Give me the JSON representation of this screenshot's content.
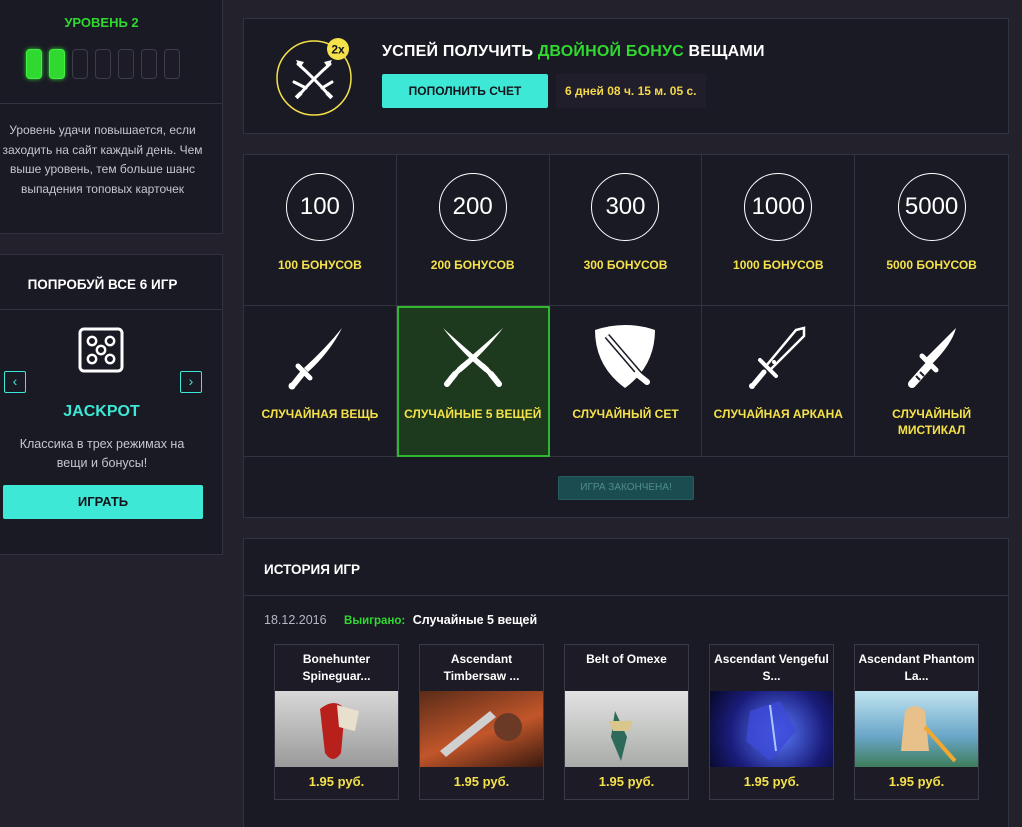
{
  "level": {
    "title": "УРОВЕНЬ 2",
    "bars_total": 7,
    "bars_filled": 2,
    "description": "Уровень удачи повышается, если заходить на сайт каждый день. Чем выше уровень, тем больше шанс выпадения топовых карточек"
  },
  "games_promo": {
    "title": "ПОПРОБУЙ ВСЕ 6 ИГР",
    "prev_icon": "‹",
    "next_icon": "›",
    "game_name": "JACKPOT",
    "game_description": "Классика в трех режимах на вещи и бонусы!",
    "play_label": "ИГРАТЬ",
    "game_icon": "dice-icon"
  },
  "bonus_banner": {
    "badge": "2x",
    "headline_prefix": "УСПЕЙ ПОЛУЧИТЬ",
    "headline_highlight": "ДВОЙНОЙ БОНУС",
    "headline_suffix": "ВЕЩАМИ",
    "topup_label": "ПОПОЛНИТЬ СЧЕТ",
    "timer": "6 дней 08 ч. 15 м. 05 с.",
    "accent_color": "#2fd92f",
    "badge_color": "#f5e24a"
  },
  "bonus_options": [
    {
      "amount": "100",
      "label": "100 БОНУСОВ"
    },
    {
      "amount": "200",
      "label": "200 БОНУСОВ"
    },
    {
      "amount": "300",
      "label": "300 БОНУСОВ"
    },
    {
      "amount": "1000",
      "label": "1000 БОНУСОВ"
    },
    {
      "amount": "5000",
      "label": "5000 БОНУСОВ"
    }
  ],
  "item_options": [
    {
      "label": "СЛУЧАЙНАЯ ВЕЩЬ",
      "icon": "sword-icon",
      "selected": false
    },
    {
      "label": "СЛУЧАЙНЫЕ 5 ВЕЩЕЙ",
      "icon": "crossed-swords-icon",
      "selected": true
    },
    {
      "label": "СЛУЧАЙНЫЙ СЕТ",
      "icon": "shield-sword-icon",
      "selected": false
    },
    {
      "label": "СЛУЧАЙНАЯ АРКАНА",
      "icon": "ornate-sword-icon",
      "selected": false
    },
    {
      "label": "СЛУЧАЙНЫЙ МИСТИКАЛ",
      "icon": "dagger-icon",
      "selected": false
    }
  ],
  "game_over_label": "ИГРА ЗАКОНЧЕНА!",
  "history": {
    "title": "ИСТОРИЯ ИГР",
    "date": "18.12.2016",
    "won_label": "Выиграно:",
    "result": "Случайные 5 вещей",
    "cards": [
      {
        "name": "Bonehunter Spineguar...",
        "price": "1.95 руб."
      },
      {
        "name": "Ascendant Timbersaw ...",
        "price": "1.95 руб."
      },
      {
        "name": "Belt of Omexe",
        "price": "1.95 руб."
      },
      {
        "name": "Ascendant Vengeful S...",
        "price": "1.95 руб."
      },
      {
        "name": "Ascendant Phantom La...",
        "price": "1.95 руб."
      }
    ]
  },
  "colors": {
    "accent_cyan": "#3ee8d6",
    "accent_green": "#2fd92f",
    "accent_yellow": "#f5e24a",
    "panel_bg": "#1a1a24",
    "page_bg": "#22212c"
  }
}
